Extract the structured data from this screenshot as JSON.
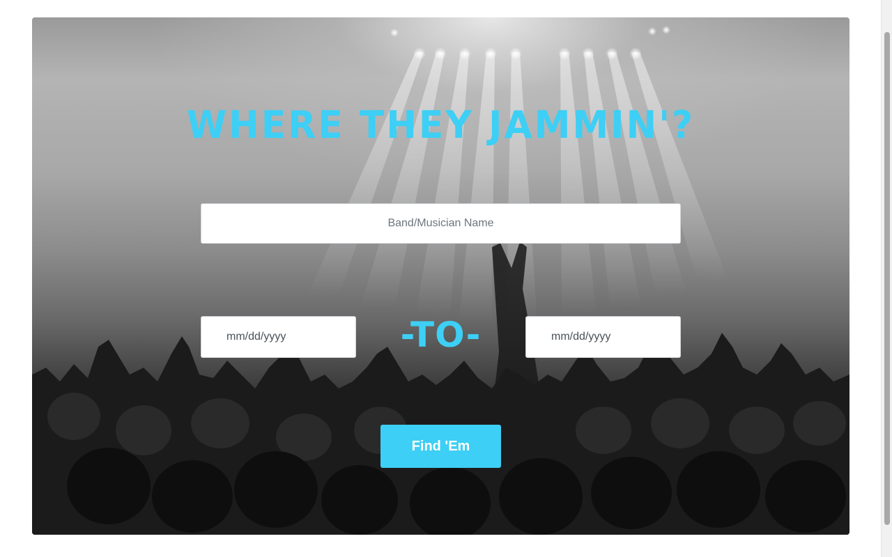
{
  "hero": {
    "title": "Where They Jammin'?"
  },
  "search": {
    "band_placeholder": "Band/Musician Name",
    "band_value": "",
    "date_from_placeholder": "mm/dd/yyyy",
    "date_to_placeholder": "mm/dd/yyyy",
    "to_label": "-To-",
    "submit_label": "Find 'Em"
  },
  "theme": {
    "accent_color": "#3dcff5",
    "background_image": "concert-crowd-photo"
  },
  "icons": {
    "background": "concert-crowd-image"
  }
}
